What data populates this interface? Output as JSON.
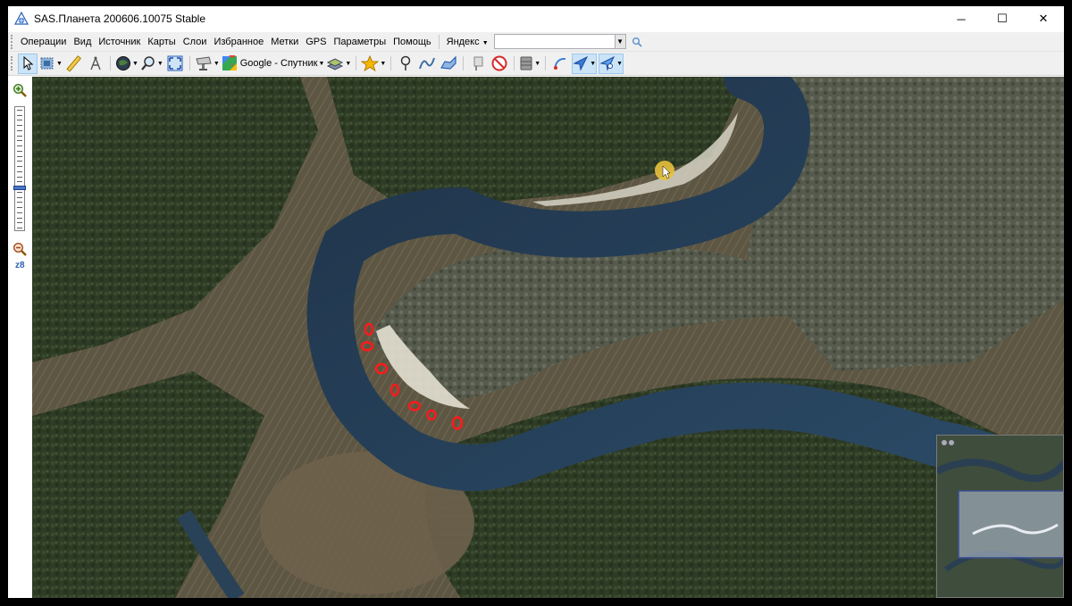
{
  "window": {
    "title": "SAS.Планета 200606.10075 Stable",
    "controls": {
      "minimize": "─",
      "maximize": "☐",
      "close": "✕"
    }
  },
  "menu": {
    "items": [
      "Операции",
      "Вид",
      "Источник",
      "Карты",
      "Слои",
      "Избранное",
      "Метки",
      "GPS",
      "Параметры",
      "Помощь"
    ],
    "search_provider": "Яндекс",
    "search_value": ""
  },
  "toolbar": {
    "map_source_label": "Google - Спутник"
  },
  "zoom": {
    "level_label": "z8",
    "level_fraction": 0.67
  },
  "icons": {
    "app": "globe-icon",
    "select": "cursor-arrow-icon",
    "ruler": "ruler-icon",
    "compass": "compass-icon",
    "globe": "globe-icon",
    "search": "magnifier-icon",
    "fullscreen": "fullscreen-icon",
    "satellite": "satellite-dish-icon",
    "google_maps": "google-maps-icon",
    "layers": "layers-icon",
    "star": "star-icon",
    "placemark": "placemark-pin-icon",
    "path": "path-line-icon",
    "polygon": "polygon-icon",
    "marks_show": "marks-show-icon",
    "marks_hide": "marks-hide-icon",
    "cache": "cache-db-icon",
    "gps1": "gps-track-icon",
    "gps2": "gps-connect-icon",
    "gps3": "gps-settings-icon",
    "zoom_in": "zoom-in-icon",
    "zoom_out": "zoom-out-icon"
  },
  "colors": {
    "accent": "#2a5fb5",
    "marker_red": "#ff1a1a",
    "river": "#233a52"
  }
}
